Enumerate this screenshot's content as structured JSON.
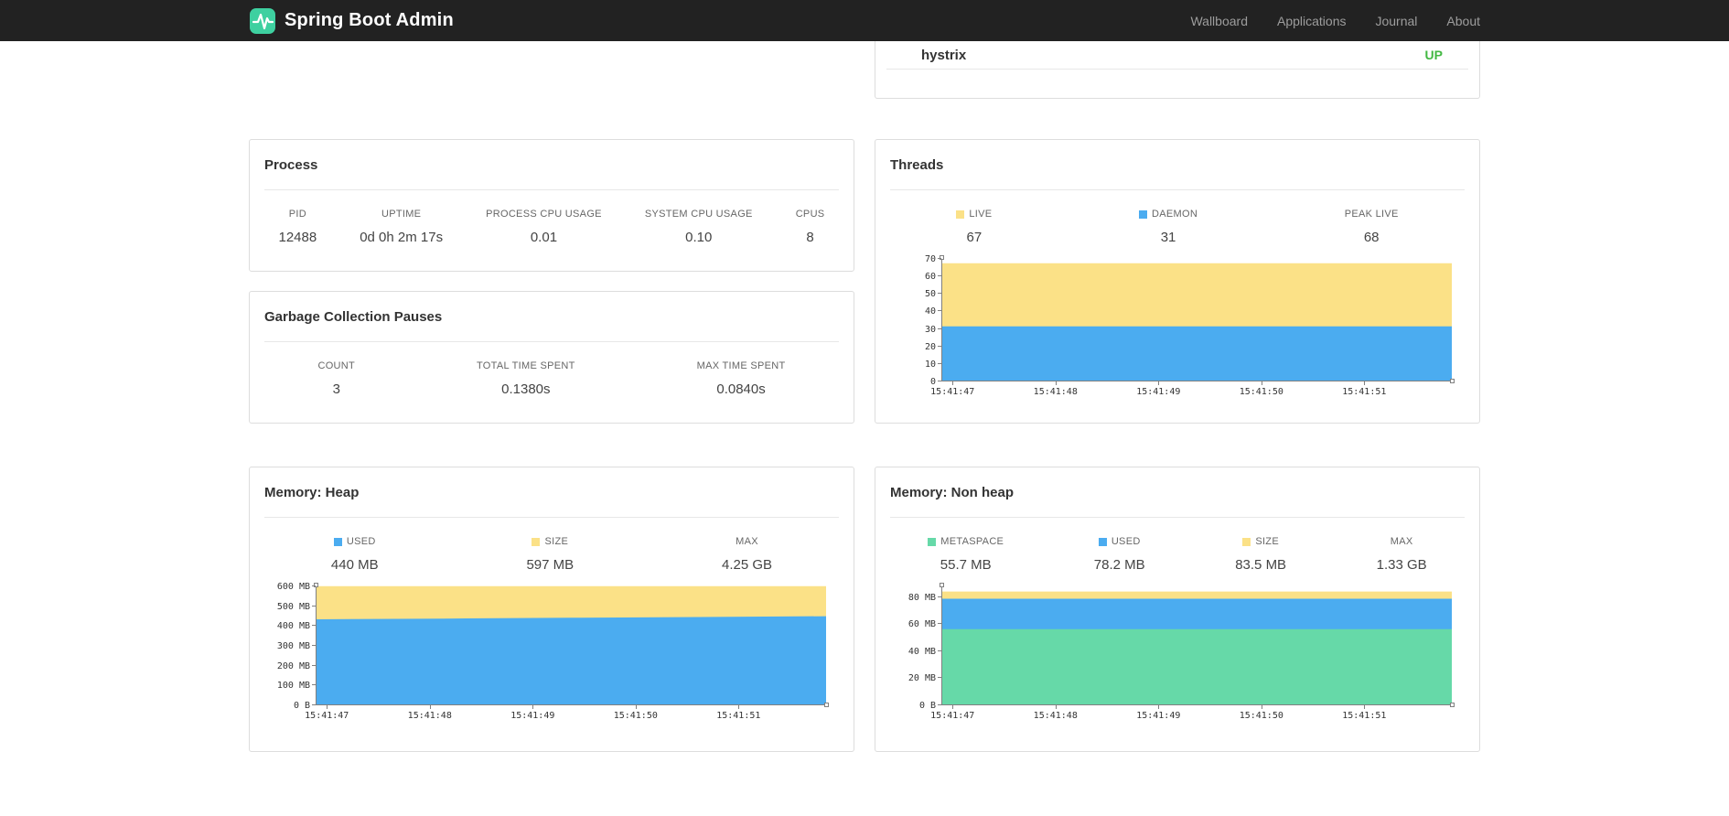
{
  "colors": {
    "navbar_bg": "#222222",
    "nav_link": "#9d9d9d",
    "brand_green": "#3ed0a0",
    "status_up": "#42b842",
    "chart_yellow": "#FBE187",
    "chart_blue": "#4BACF0",
    "chart_green": "#66D9A8",
    "panel_border": "#dddddd"
  },
  "navbar": {
    "brand": "Spring Boot Admin",
    "links": [
      {
        "label": "Wallboard"
      },
      {
        "label": "Applications"
      },
      {
        "label": "Journal"
      },
      {
        "label": "About"
      }
    ]
  },
  "application_list": {
    "items": [
      {
        "name": "hystrix",
        "status": "UP"
      }
    ]
  },
  "panels": {
    "process": {
      "title": "Process",
      "stats": [
        {
          "label": "PID",
          "value": "12488"
        },
        {
          "label": "UPTIME",
          "value": "0d 0h 2m 17s"
        },
        {
          "label": "PROCESS CPU USAGE",
          "value": "0.01"
        },
        {
          "label": "SYSTEM CPU USAGE",
          "value": "0.10"
        },
        {
          "label": "CPUS",
          "value": "8"
        }
      ]
    },
    "gc": {
      "title": "Garbage Collection Pauses",
      "stats": [
        {
          "label": "COUNT",
          "value": "3"
        },
        {
          "label": "TOTAL TIME SPENT",
          "value": "0.1380s"
        },
        {
          "label": "MAX TIME SPENT",
          "value": "0.0840s"
        }
      ]
    },
    "threads": {
      "title": "Threads",
      "stats": [
        {
          "label": "LIVE",
          "value": "67",
          "swatch": "#FBE187"
        },
        {
          "label": "DAEMON",
          "value": "31",
          "swatch": "#4BACF0"
        },
        {
          "label": "PEAK LIVE",
          "value": "68"
        }
      ]
    },
    "heap": {
      "title": "Memory: Heap",
      "stats": [
        {
          "label": "USED",
          "value": "440 MB",
          "swatch": "#4BACF0"
        },
        {
          "label": "SIZE",
          "value": "597 MB",
          "swatch": "#FBE187"
        },
        {
          "label": "MAX",
          "value": "4.25 GB"
        }
      ]
    },
    "nonheap": {
      "title": "Memory: Non heap",
      "stats": [
        {
          "label": "METASPACE",
          "value": "55.7 MB",
          "swatch": "#66D9A8"
        },
        {
          "label": "USED",
          "value": "78.2 MB",
          "swatch": "#4BACF0"
        },
        {
          "label": "SIZE",
          "value": "83.5 MB",
          "swatch": "#FBE187"
        },
        {
          "label": "MAX",
          "value": "1.33 GB"
        }
      ]
    }
  },
  "chart_data": [
    {
      "id": "threads",
      "type": "area",
      "title": "Threads",
      "legend": [
        "LIVE",
        "DAEMON"
      ],
      "legend_position": "top",
      "grid": false,
      "xlabel": "",
      "ylabel": "",
      "x": [
        "15:41:47",
        "15:41:48",
        "15:41:49",
        "15:41:50",
        "15:41:51"
      ],
      "ylim": [
        0,
        70
      ],
      "yticks": [
        0,
        10,
        20,
        30,
        40,
        50,
        60,
        70
      ],
      "ytick_labels": [
        "0",
        "10",
        "20",
        "30",
        "40",
        "50",
        "60",
        "70"
      ],
      "series": [
        {
          "name": "LIVE",
          "color": "#FBE187",
          "values": [
            67,
            67,
            67,
            67,
            67
          ]
        },
        {
          "name": "DAEMON",
          "color": "#4BACF0",
          "values": [
            31,
            31,
            31,
            31,
            31
          ]
        }
      ]
    },
    {
      "id": "heap",
      "type": "area",
      "title": "Memory: Heap",
      "legend": [
        "USED",
        "SIZE"
      ],
      "legend_position": "top",
      "grid": false,
      "xlabel": "",
      "ylabel": "",
      "x": [
        "15:41:47",
        "15:41:48",
        "15:41:49",
        "15:41:50",
        "15:41:51"
      ],
      "ylim": [
        0,
        600
      ],
      "yticks": [
        0,
        100,
        200,
        300,
        400,
        500,
        600
      ],
      "ytick_labels": [
        "0 B",
        "100 MB",
        "200 MB",
        "300 MB",
        "400 MB",
        "500 MB",
        "600 MB"
      ],
      "series": [
        {
          "name": "SIZE",
          "color": "#FBE187",
          "values": [
            597,
            597,
            597,
            597,
            597
          ]
        },
        {
          "name": "USED",
          "color": "#4BACF0",
          "values": [
            429,
            433,
            437,
            441,
            445
          ]
        }
      ]
    },
    {
      "id": "nonheap",
      "type": "area",
      "title": "Memory: Non heap",
      "legend": [
        "METASPACE",
        "USED",
        "SIZE"
      ],
      "legend_position": "top",
      "grid": false,
      "xlabel": "",
      "ylabel": "",
      "x": [
        "15:41:47",
        "15:41:48",
        "15:41:49",
        "15:41:50",
        "15:41:51"
      ],
      "ylim": [
        0,
        88
      ],
      "yticks": [
        0,
        20,
        40,
        60,
        80
      ],
      "ytick_labels": [
        "0 B",
        "20 MB",
        "40 MB",
        "60 MB",
        "80 MB"
      ],
      "series": [
        {
          "name": "SIZE",
          "color": "#FBE187",
          "values": [
            83.5,
            83.5,
            83.5,
            83.5,
            83.5
          ]
        },
        {
          "name": "USED",
          "color": "#4BACF0",
          "values": [
            78.2,
            78.2,
            78.2,
            78.2,
            78.2
          ]
        },
        {
          "name": "METASPACE",
          "color": "#66D9A8",
          "values": [
            55.7,
            55.7,
            55.7,
            55.7,
            55.7
          ]
        }
      ]
    }
  ]
}
